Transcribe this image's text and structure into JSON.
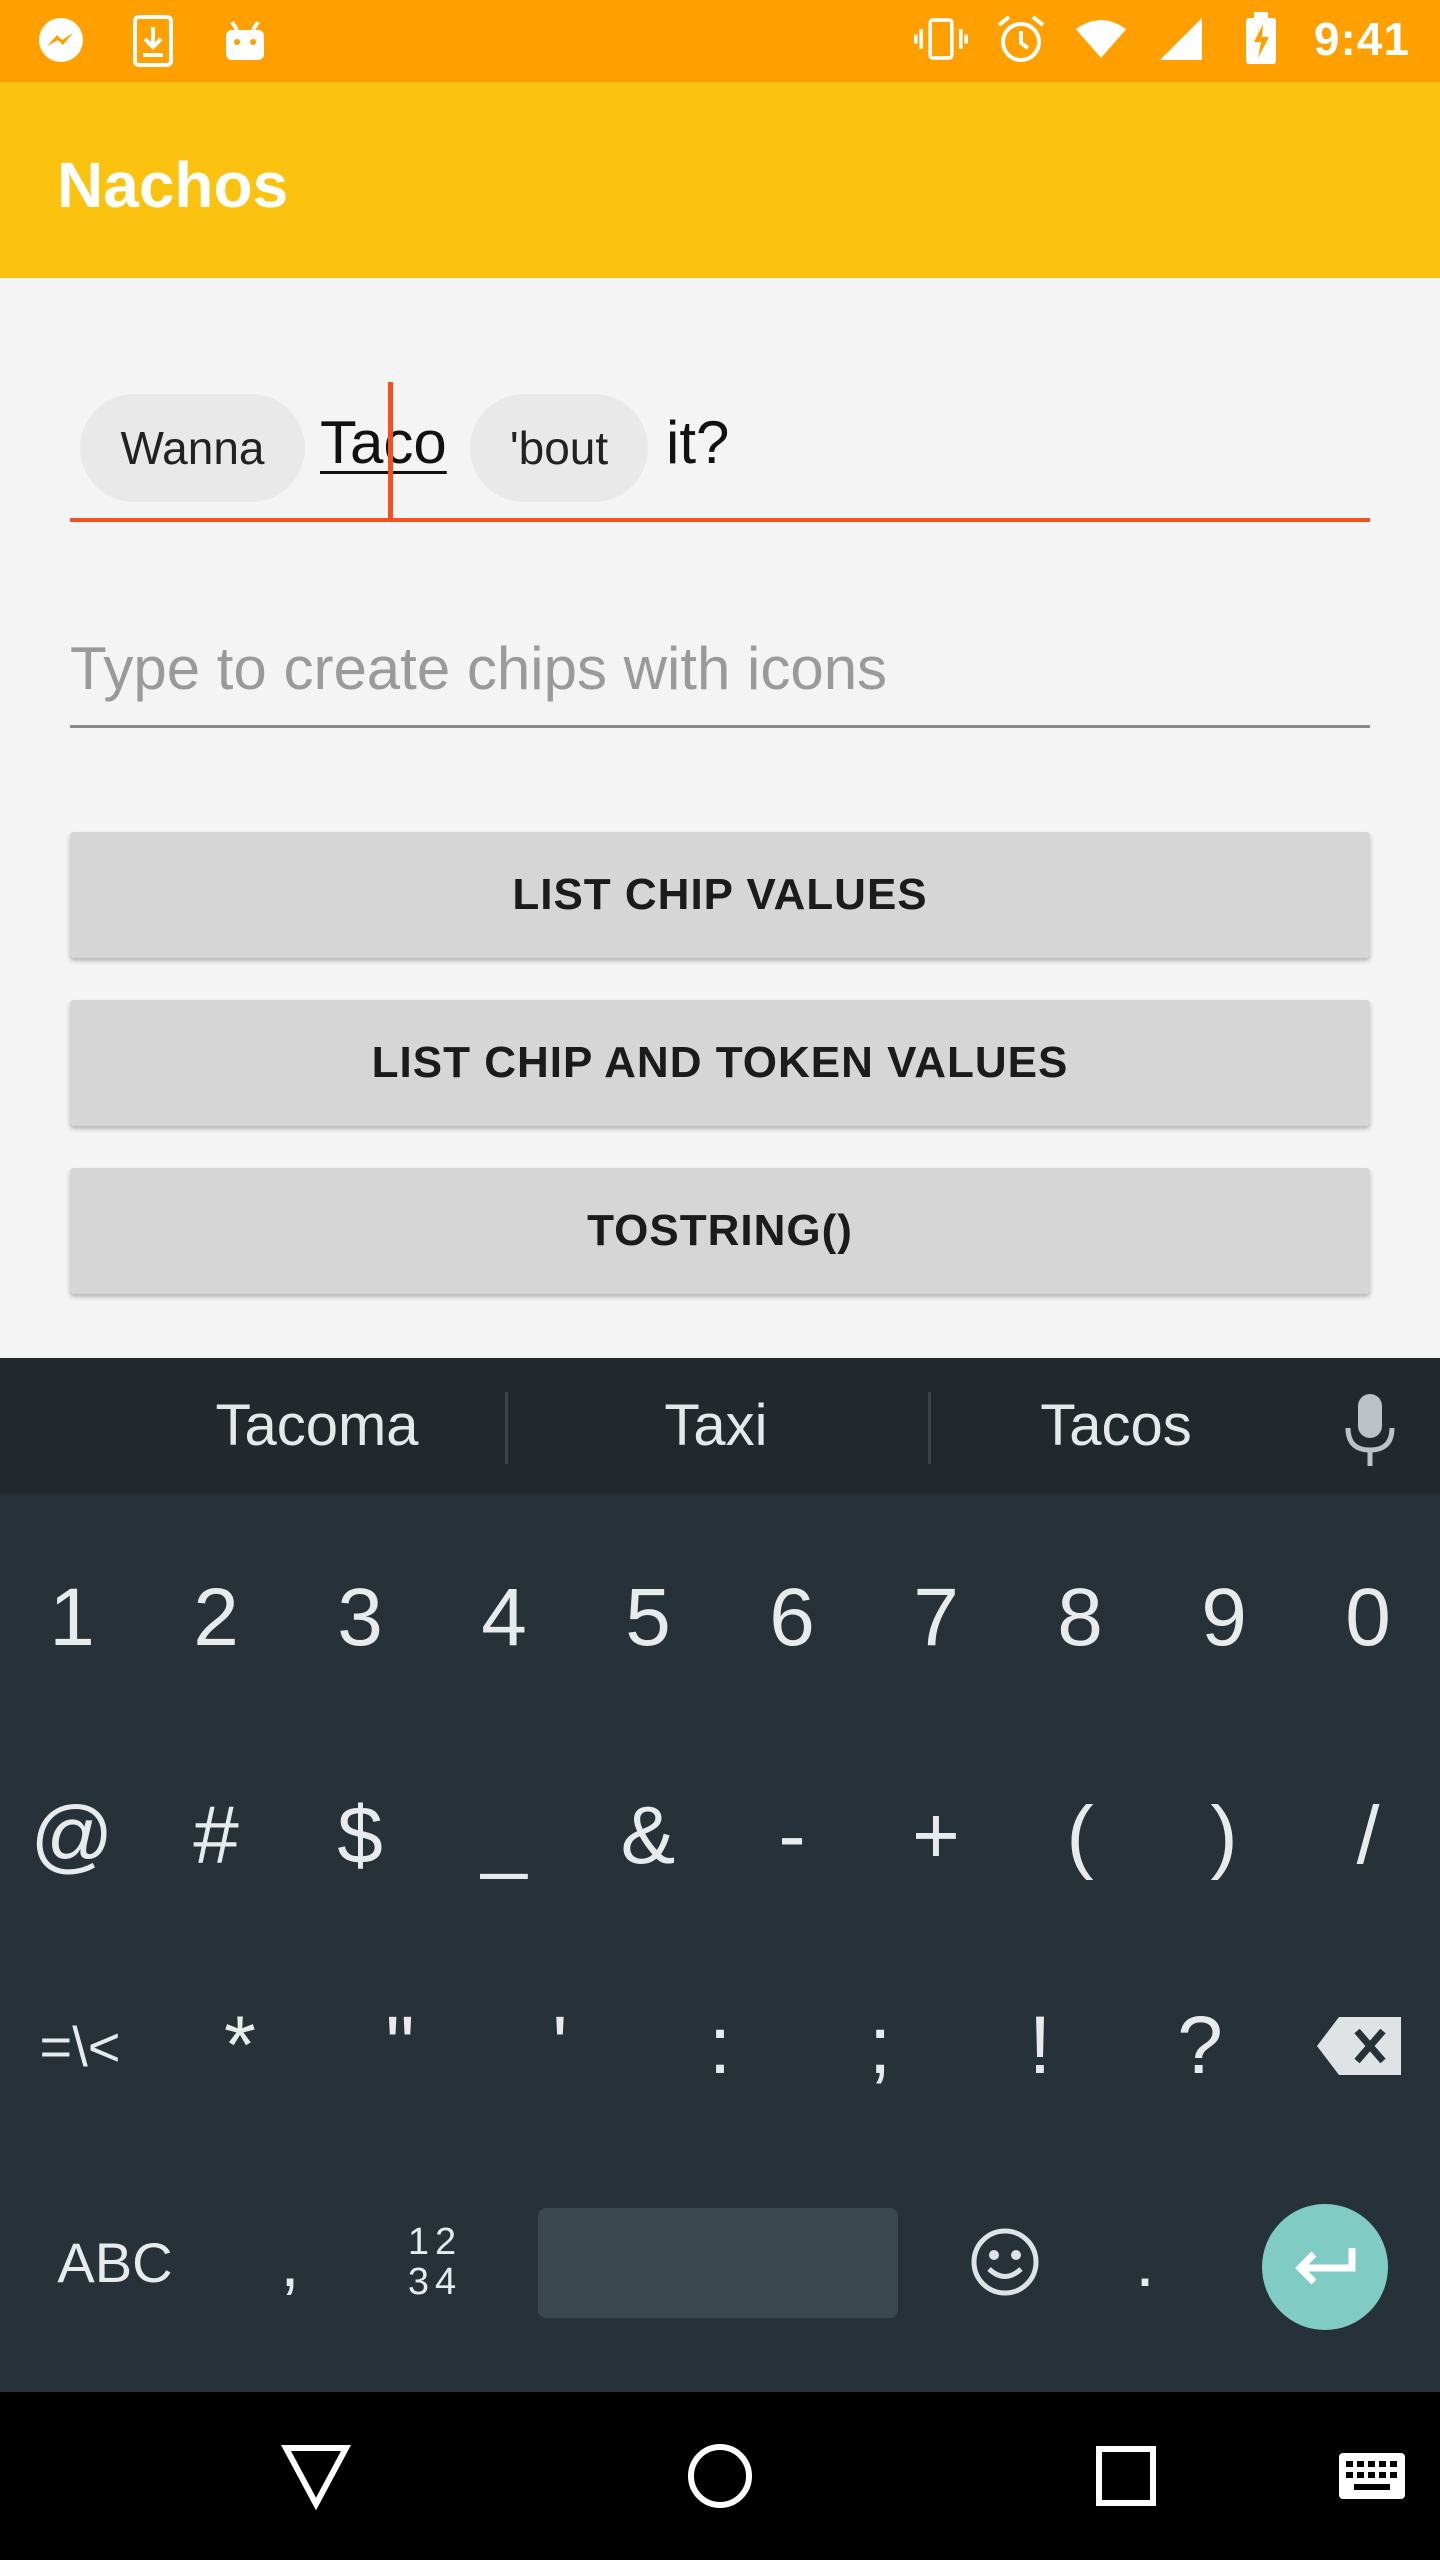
{
  "app": {
    "title": "Nachos"
  },
  "status_bar": {
    "time": "9:41",
    "left_icons": [
      "messenger-icon",
      "download-icon",
      "android-icon"
    ],
    "right_icons": [
      "vibrate-icon",
      "alarm-icon",
      "wifi-icon",
      "signal-icon",
      "battery-charging-icon"
    ]
  },
  "chip_field": {
    "chips": [
      "Wanna",
      "'bout"
    ],
    "token_active": "Taco",
    "trailing_text": "it?"
  },
  "icon_field": {
    "placeholder": "Type to create chips with icons"
  },
  "buttons": {
    "list_chip_values": "LIST CHIP VALUES",
    "list_chip_token_values": "LIST CHIP AND TOKEN VALUES",
    "tostring": "TOSTRING()"
  },
  "keyboard": {
    "suggestions": [
      "Tacoma",
      "Taxi",
      "Tacos"
    ],
    "row_numbers": [
      "1",
      "2",
      "3",
      "4",
      "5",
      "6",
      "7",
      "8",
      "9",
      "0"
    ],
    "row_symbols": [
      "@",
      "#",
      "$",
      "_",
      "&",
      "-",
      "+",
      "(",
      ")",
      "/"
    ],
    "row_symbols2": [
      "=\\<",
      "*",
      "\"",
      "'",
      ":",
      ";",
      "!",
      "?"
    ],
    "abc": "ABC",
    "comma": ",",
    "numpad_line1": "12",
    "numpad_line2": "34",
    "period": "."
  },
  "colors": {
    "status_bar": "#ffa000",
    "app_bar": "#fbc310",
    "accent": "#f4511e",
    "keyboard_bg": "#263238",
    "enter_key": "#80cbc4"
  }
}
